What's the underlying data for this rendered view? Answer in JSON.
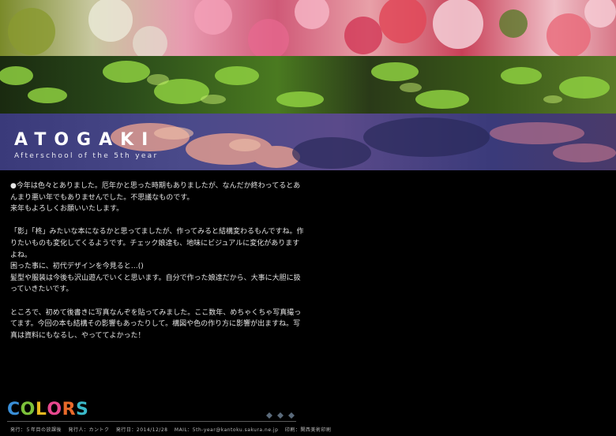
{
  "header": {
    "title": "ATOGAKI",
    "subtitle": "Afterschool of the 5th year"
  },
  "body": {
    "paragraphs": [
      "●今年は色々とありました。厄年かと思った時期もありましたが、なんだか終わってるとあんまり悪い年でもありませんでした。不思議なものです。\n来年もよろしくお願いいたします。",
      "「影」「柊」みたいな本になるかと思ってましたが、作ってみると結構変わるもんですね。作りたいものも変化してくるようです。チェック娘達も、地味にビジュアルに変化がありますよね。\n困った事に、初代デザインを今見ると…()\n髪型や服装は今後も沢山遊んでいくと思います。自分で作った娘達だから、大事に大胆に扱っていきたいです。",
      "ところで、初めて後書きに写真なんぞを貼ってみました。ここ数年、めちゃくちゃ写真撮ってます。今回の本も結構その影響もあったりして。構図や色の作り方に影響が出ますね。写真は資料にもなるし、やっててよかった！"
    ]
  },
  "logo": {
    "letters": [
      "C",
      "O",
      "L",
      "O",
      "R",
      "S"
    ],
    "colors": [
      "#3a8fd8",
      "#7cc03a",
      "#e8b820",
      "#e84890",
      "#e86a2a",
      "#3ab8c8"
    ]
  },
  "footer": {
    "publisher": "発行：５年目の放課後",
    "issuer": "発行人：カントク",
    "date": "発行日：2014/12/28",
    "mail": "MAIL：5th-year@kantoku.sakura.ne.jp",
    "printer": "印刷：関西美術印刷"
  },
  "palette": {
    "background": "#000000",
    "text": "#e4e4e4",
    "deco": "#5a6a7a"
  }
}
